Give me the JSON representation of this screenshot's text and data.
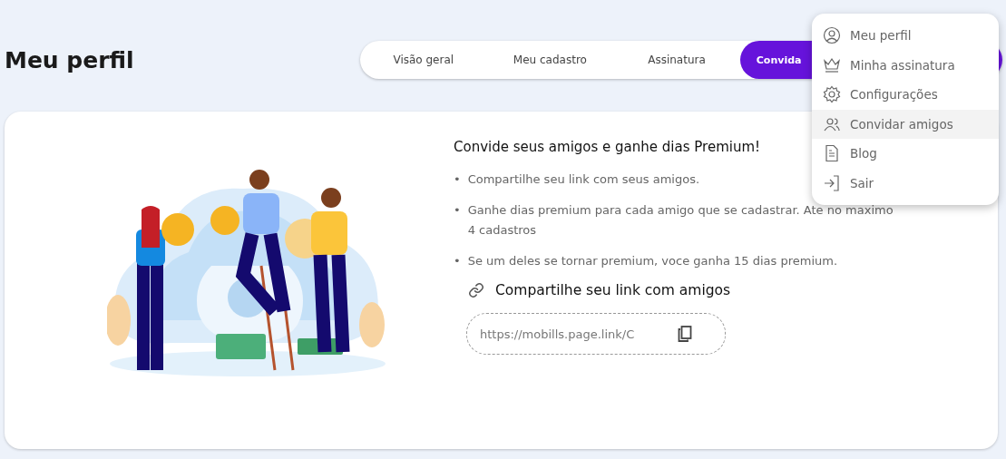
{
  "page_title": "Meu perfil",
  "tabs": [
    {
      "label": "Visão geral",
      "selected": false
    },
    {
      "label": "Meu cadastro",
      "selected": false
    },
    {
      "label": "Assinatura",
      "selected": false
    },
    {
      "label": "Convida",
      "selected": true
    }
  ],
  "menu": [
    {
      "label": "Meu perfil",
      "selected": false
    },
    {
      "label": "Minha assinatura",
      "selected": false
    },
    {
      "label": "Configurações",
      "selected": false
    },
    {
      "label": "Convidar amigos",
      "selected": true
    },
    {
      "label": "Blog",
      "selected": false
    },
    {
      "label": "Sair",
      "selected": false
    }
  ],
  "invite": {
    "heading": "Convide seus amigos e ganhe dias Premium!",
    "bullets": [
      {
        "marker": "•",
        "text": "Compartilhe seu link com seus amigos."
      },
      {
        "marker": "•",
        "text": "Ganhe dias premium para cada amigo que se cadastrar. Ate no maximo 4 cadastros"
      },
      {
        "marker": "•",
        "text": "Se um deles se tornar premium, voce ganha 15 dias premium."
      }
    ],
    "share_title": "Compartilhe seu link com amigos",
    "link": "https://mobills.page.link/C"
  }
}
